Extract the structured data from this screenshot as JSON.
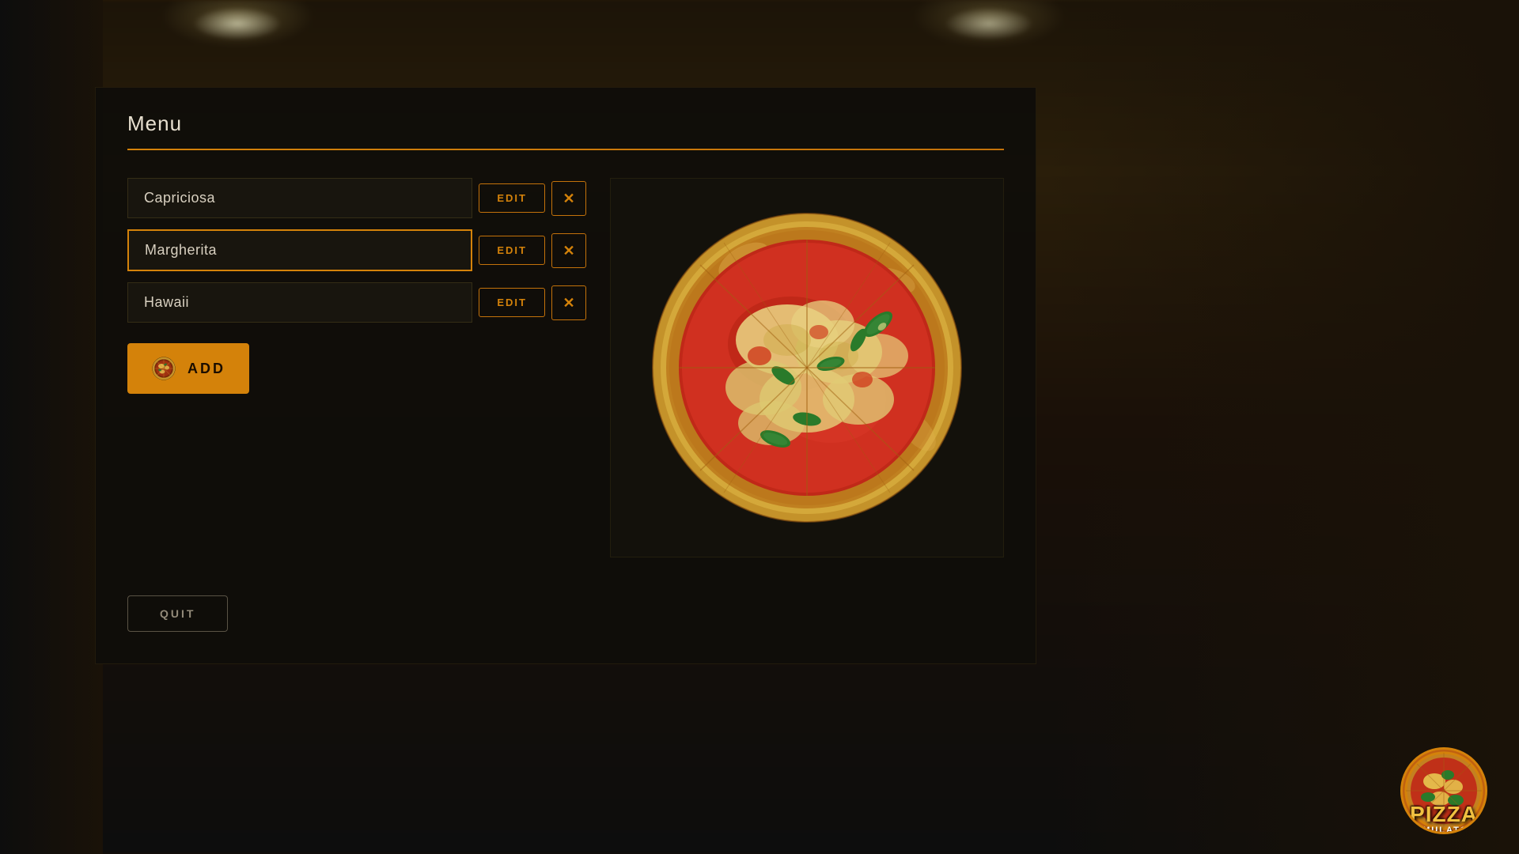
{
  "panel": {
    "title": "Menu",
    "divider_color": "#d4820a"
  },
  "menu_items": [
    {
      "id": "capriciosa",
      "name": "Capriciosa",
      "selected": false,
      "edit_label": "EDIT",
      "delete_label": "✕"
    },
    {
      "id": "margherita",
      "name": "Margherita",
      "selected": true,
      "edit_label": "EDIT",
      "delete_label": "✕"
    },
    {
      "id": "hawaii",
      "name": "Hawaii",
      "selected": false,
      "edit_label": "EDIT",
      "delete_label": "✕"
    }
  ],
  "add_button": {
    "label": "ADD",
    "icon": "pizza-icon"
  },
  "quit_button": {
    "label": "QUIT"
  },
  "preview": {
    "alt": "Margherita pizza preview"
  },
  "logo": {
    "pizza_word": "PIZZA",
    "simulator_word": "SIMULATOR"
  }
}
